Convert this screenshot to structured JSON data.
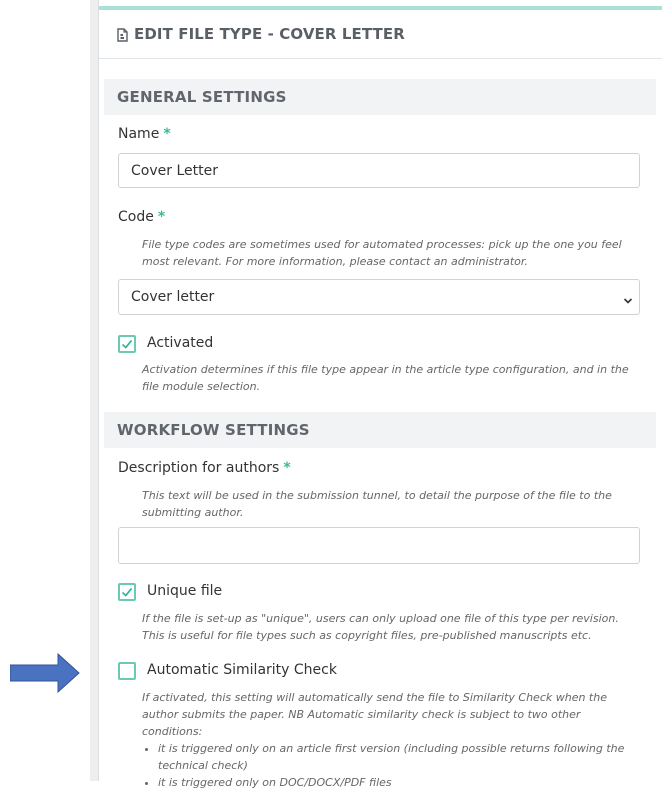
{
  "header": {
    "title": "EDIT FILE TYPE - COVER LETTER",
    "icon": "file-icon"
  },
  "general": {
    "title": "GENERAL SETTINGS",
    "name_label": "Name",
    "name_value": "Cover Letter",
    "code_label": "Code",
    "code_help": "File type codes are sometimes used for automated processes: pick up the one you feel most relevant. For more information, please contact an administrator.",
    "code_value": "Cover letter",
    "activated_label": "Activated",
    "activated_checked": true,
    "activated_help": "Activation determines if this file type appear in the article type configuration, and in the file module selection."
  },
  "workflow": {
    "title": "WORKFLOW SETTINGS",
    "desc_label": "Description for authors",
    "desc_help": "This text will be used in the submission tunnel, to detail the purpose of the file to the submitting author.",
    "desc_value": "",
    "unique_label": "Unique file",
    "unique_checked": true,
    "unique_help": "If the file is set-up as \"unique\", users can only upload one file of this type per revision. This is useful for file types such as copyright files, pre-published manuscripts etc.",
    "similarity_label": "Automatic Similarity Check",
    "similarity_checked": false,
    "similarity_help": "If activated, this setting will automatically send the file to Similarity Check when the author submits the paper. NB Automatic similarity check is subject to two other conditions:",
    "similarity_conditions": [
      "it is triggered only on an article first version (including possible returns following the technical check)",
      "it is triggered only on DOC/DOCX/PDF files"
    ]
  },
  "required_mark": "*",
  "colors": {
    "accent": "#36b99a",
    "arrow": "#4a72c0"
  }
}
